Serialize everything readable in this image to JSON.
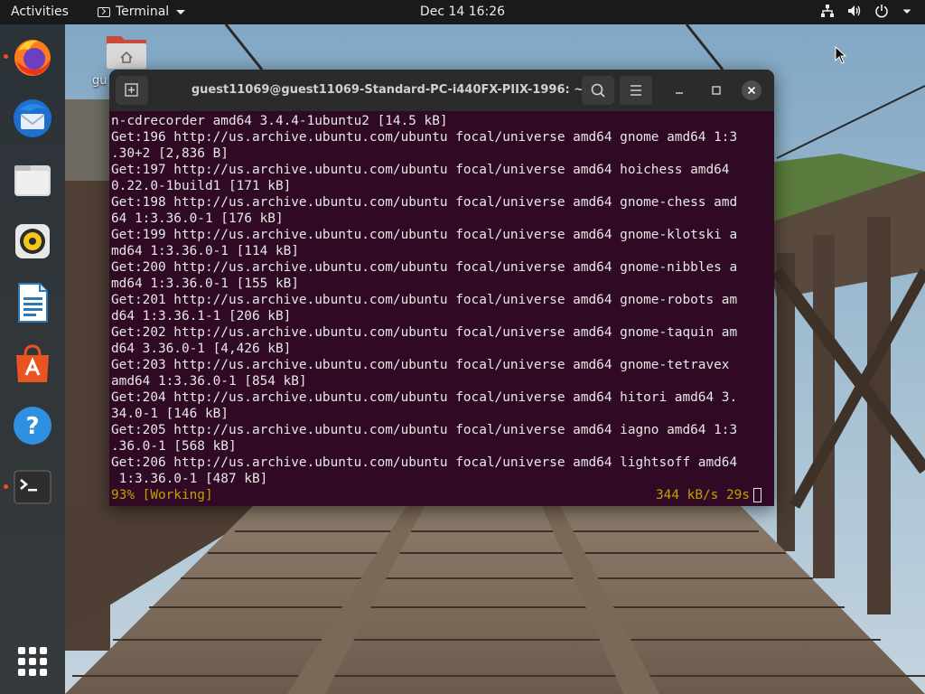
{
  "topbar": {
    "activities": "Activities",
    "app_name": "Terminal",
    "clock": "Dec 14  16:26",
    "tray_icons": [
      "network-icon",
      "volume-icon",
      "power-icon",
      "chevron-down-icon"
    ]
  },
  "dock": {
    "items": [
      {
        "name": "firefox-icon",
        "running": true
      },
      {
        "name": "thunderbird-icon",
        "running": false
      },
      {
        "name": "files-icon",
        "running": false
      },
      {
        "name": "rhythmbox-icon",
        "running": false
      },
      {
        "name": "libreoffice-writer-icon",
        "running": false
      },
      {
        "name": "ubuntu-software-icon",
        "running": false
      },
      {
        "name": "help-icon",
        "running": false
      },
      {
        "name": "terminal-icon",
        "running": true
      }
    ],
    "show_apps": "app-grid-icon"
  },
  "desktop": {
    "home_label": "gu"
  },
  "terminal": {
    "title": "guest11069@guest11069-Standard-PC-i440FX-PIIX-1996: ~",
    "lines": [
      "n-cdrecorder amd64 3.4.4-1ubuntu2 [14.5 kB]",
      "Get:196 http://us.archive.ubuntu.com/ubuntu focal/universe amd64 gnome amd64 1:3",
      ".30+2 [2,836 B]",
      "Get:197 http://us.archive.ubuntu.com/ubuntu focal/universe amd64 hoichess amd64",
      "0.22.0-1build1 [171 kB]",
      "Get:198 http://us.archive.ubuntu.com/ubuntu focal/universe amd64 gnome-chess amd",
      "64 1:3.36.0-1 [176 kB]",
      "Get:199 http://us.archive.ubuntu.com/ubuntu focal/universe amd64 gnome-klotski a",
      "md64 1:3.36.0-1 [114 kB]",
      "Get:200 http://us.archive.ubuntu.com/ubuntu focal/universe amd64 gnome-nibbles a",
      "md64 1:3.36.0-1 [155 kB]",
      "Get:201 http://us.archive.ubuntu.com/ubuntu focal/universe amd64 gnome-robots am",
      "d64 1:3.36.1-1 [206 kB]",
      "Get:202 http://us.archive.ubuntu.com/ubuntu focal/universe amd64 gnome-taquin am",
      "d64 3.36.0-1 [4,426 kB]",
      "Get:203 http://us.archive.ubuntu.com/ubuntu focal/universe amd64 gnome-tetravex",
      "amd64 1:3.36.0-1 [854 kB]",
      "Get:204 http://us.archive.ubuntu.com/ubuntu focal/universe amd64 hitori amd64 3.",
      "34.0-1 [146 kB]",
      "Get:205 http://us.archive.ubuntu.com/ubuntu focal/universe amd64 iagno amd64 1:3",
      ".36.0-1 [568 kB]",
      "Get:206 http://us.archive.ubuntu.com/ubuntu focal/universe amd64 lightsoff amd64",
      " 1:3.36.0-1 [487 kB]"
    ],
    "status_left": "93% [Working]",
    "status_right": "344 kB/s 29s",
    "colors": {
      "background": "#300a24",
      "text": "#e7e7e7",
      "status": "#c4a000"
    }
  }
}
